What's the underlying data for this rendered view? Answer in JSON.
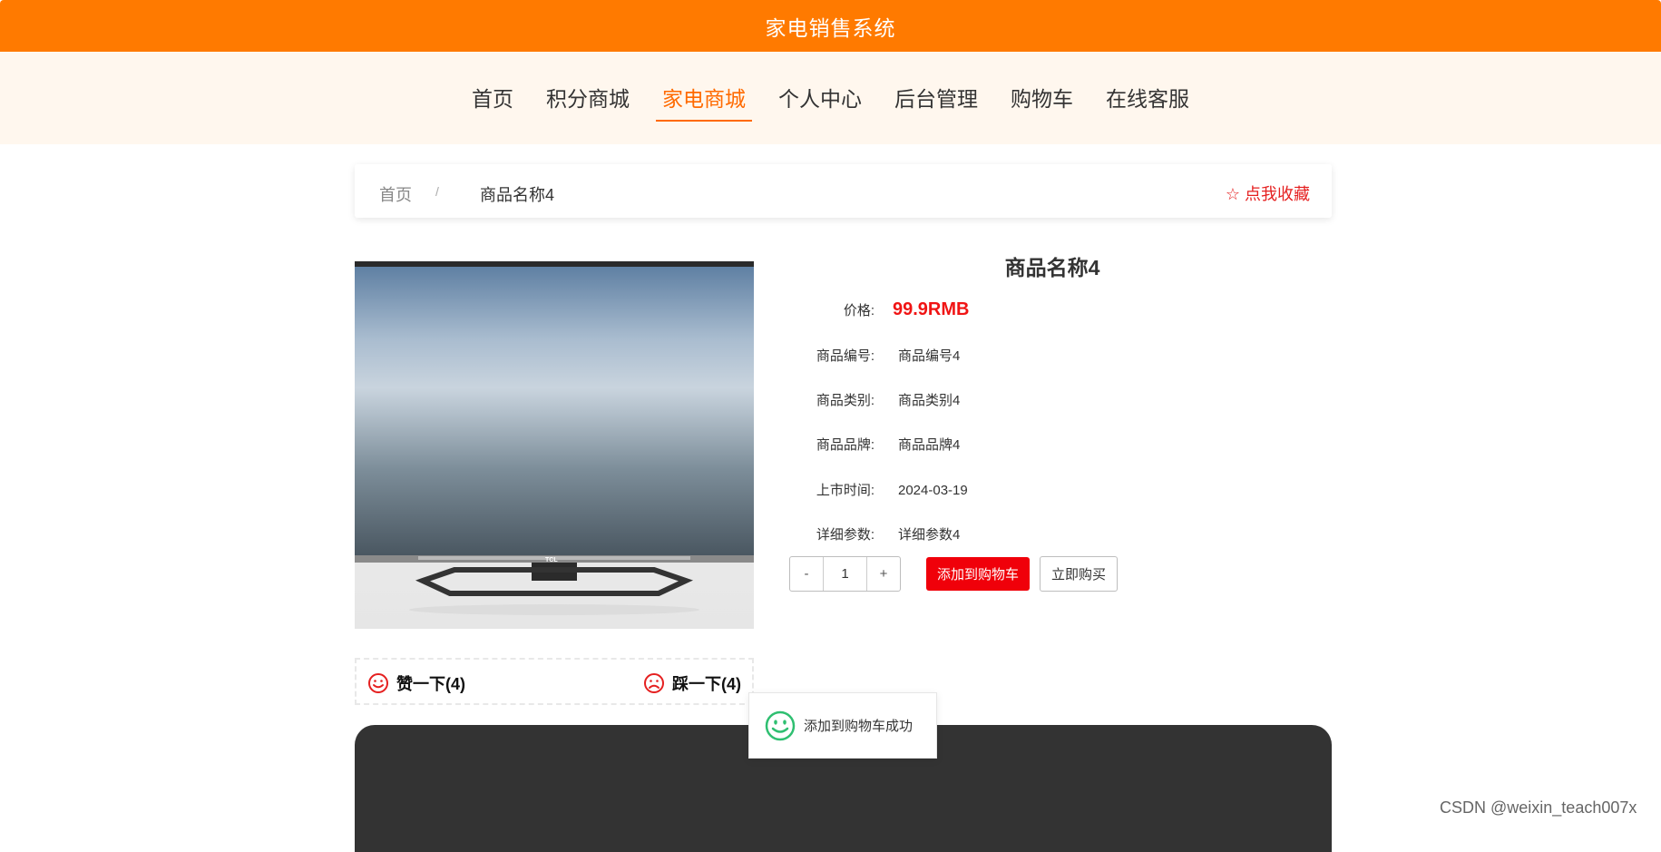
{
  "header": {
    "title": "家电销售系统"
  },
  "nav": {
    "items": [
      {
        "label": "首页"
      },
      {
        "label": "积分商城"
      },
      {
        "label": "家电商城",
        "active": true
      },
      {
        "label": "个人中心"
      },
      {
        "label": "后台管理"
      },
      {
        "label": "购物车"
      },
      {
        "label": "在线客服"
      }
    ]
  },
  "breadcrumb": {
    "home": "首页",
    "separator": "/",
    "current": "商品名称4",
    "favorite": "☆ 点我收藏"
  },
  "product": {
    "name": "商品名称4",
    "price_label": "价格:",
    "price": "99.9RMB",
    "fields": [
      {
        "label": "商品编号:",
        "value": "商品编号4"
      },
      {
        "label": "商品类别:",
        "value": "商品类别4"
      },
      {
        "label": "商品品牌:",
        "value": "商品品牌4"
      },
      {
        "label": "上市时间:",
        "value": "2024-03-19"
      },
      {
        "label": "详细参数:",
        "value": "详细参数4"
      }
    ],
    "image_brand_text": "TCL"
  },
  "quantity": {
    "minus": "-",
    "value": "1",
    "plus": "+"
  },
  "actions": {
    "add_to_cart": "添加到购物车",
    "buy_now": "立即购买"
  },
  "votes": {
    "like": "赞一下(4)",
    "dislike": "踩一下(4)"
  },
  "toast": {
    "message": "添加到购物车成功"
  },
  "watermark": "CSDN @weixin_teach007x",
  "colors": {
    "brand": "#ff7a00",
    "accent": "#ff6a00",
    "price": "#f01414",
    "cart_button": "#f0000a",
    "success": "#2fbf71"
  }
}
